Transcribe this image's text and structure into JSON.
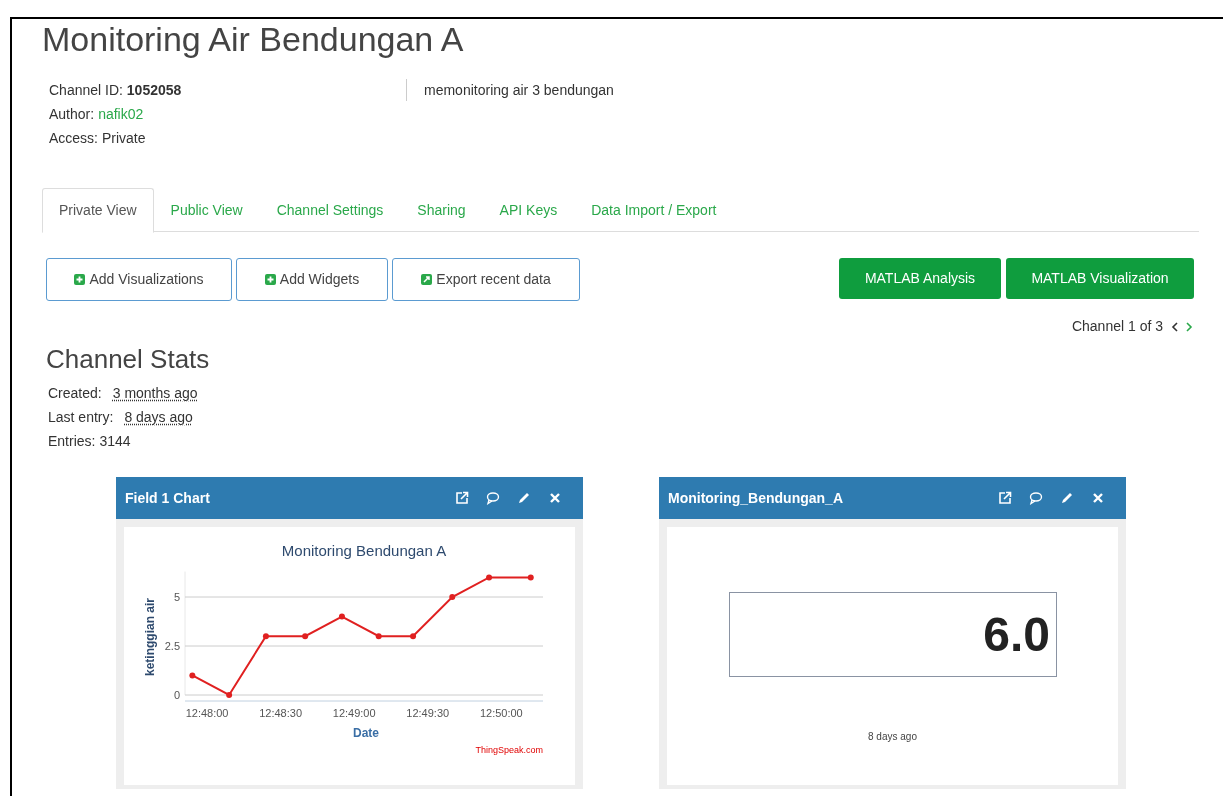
{
  "page_title": "Monitoring Air Bendungan A",
  "channel_info": {
    "channel_id_label": "Channel ID:",
    "channel_id": "1052058",
    "author_label": "Author:",
    "author": "nafik02",
    "access": "Access: Private",
    "description": "memonitoring air 3 bendungan"
  },
  "tabs": [
    {
      "label": "Private View",
      "selected": true
    },
    {
      "label": "Public View",
      "selected": false
    },
    {
      "label": "Channel Settings",
      "selected": false
    },
    {
      "label": "Sharing",
      "selected": false
    },
    {
      "label": "API Keys",
      "selected": false
    },
    {
      "label": "Data Import / Export",
      "selected": false
    }
  ],
  "action_buttons": [
    {
      "label": "Add Visualizations",
      "kind": "plus"
    },
    {
      "label": "Add Widgets",
      "kind": "plus"
    },
    {
      "label": "Export recent data",
      "kind": "export"
    }
  ],
  "matlab_buttons": [
    "MATLAB Analysis",
    "MATLAB Visualization"
  ],
  "pager": {
    "text": "Channel 1 of 3"
  },
  "stats": {
    "title": "Channel Stats",
    "rows": [
      {
        "label": "Created:",
        "value": "3 months ago",
        "kind": "time"
      },
      {
        "label": "Last entry:",
        "value": "8 days ago",
        "kind": "time"
      },
      {
        "label": "Entries:",
        "value": "3144",
        "kind": "plain"
      }
    ]
  },
  "widgets": [
    {
      "kind": "chart",
      "title": "Field 1 Chart",
      "credit": "ThingSpeak.com",
      "chart_data": {
        "type": "line",
        "title": "Monitoring Bendungan A",
        "xlabel": "Date",
        "ylabel": "ketinggian air",
        "x": [
          46074,
          46089,
          46104,
          46120,
          46135,
          46150,
          46164,
          46180,
          46195,
          46212
        ],
        "series": [
          {
            "color": "#e02020",
            "marker": "circle",
            "values": [
              1,
              0,
              3,
              3,
              4,
              3,
              3,
              5,
              6,
              6
            ]
          }
        ],
        "xlim": [
          46071,
          46217
        ],
        "ylim": [
          0,
          6.3
        ],
        "xticks": [
          {
            "value": 46080,
            "label": "12:48:00"
          },
          {
            "value": 46110,
            "label": "12:48:30"
          },
          {
            "value": 46140,
            "label": "12:49:00"
          },
          {
            "value": 46170,
            "label": "12:49:30"
          },
          {
            "value": 46200,
            "label": "12:50:00"
          }
        ],
        "yticks": [
          0,
          2.5,
          5
        ]
      }
    },
    {
      "kind": "numeric",
      "title": "Monitoring_Bendungan_A",
      "value": "6.0",
      "caption": "8 days ago"
    }
  ]
}
